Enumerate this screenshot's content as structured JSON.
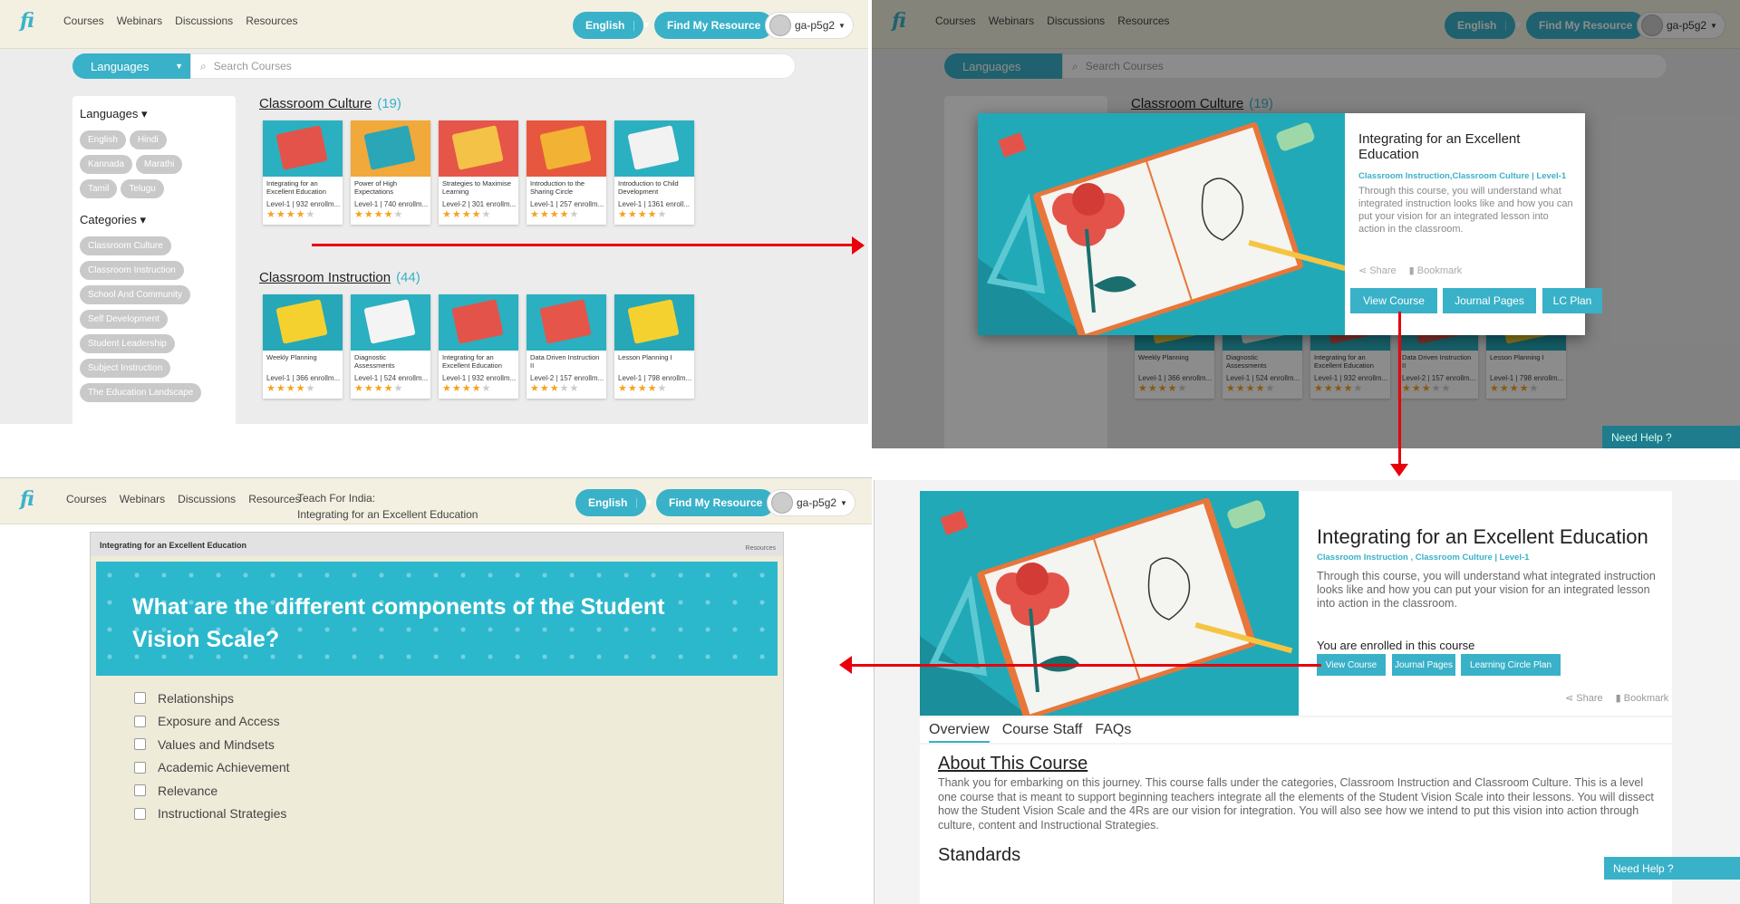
{
  "header": {
    "nav": [
      "Courses",
      "Webinars",
      "Discussions",
      "Resources"
    ],
    "language_label": "English",
    "find_resource_label": "Find My Resource",
    "user_name": "ga-p5g2",
    "breadcrumb_org": "Teach For India:",
    "breadcrumb_course": "Integrating for an Excellent Education"
  },
  "search": {
    "dropdown_label": "Languages",
    "placeholder": "Search Courses"
  },
  "sidebar": {
    "languages_title": "Languages",
    "languages": [
      "English",
      "Hindi",
      "Kannada",
      "Marathi",
      "Tamil",
      "Telugu"
    ],
    "categories_title": "Categories",
    "categories": [
      "Classroom Culture",
      "Classroom Instruction",
      "School And Community",
      "Self Development",
      "Student Leadership",
      "Subject Instruction",
      "The Education Landscape"
    ]
  },
  "sections": [
    {
      "title": "Classroom Culture",
      "count": "(19)",
      "courses": [
        {
          "title": "Integrating for an Excellent Education",
          "meta": "Level-1 | 932 enrollm...",
          "rating": 3.5
        },
        {
          "title": "Power of High Expectations",
          "meta": "Level-1 | 740 enrollm...",
          "rating": 4
        },
        {
          "title": "Strategies to Maximise Learning",
          "meta": "Level-2 | 301 enrollm...",
          "rating": 4
        },
        {
          "title": "Introduction to the Sharing Circle",
          "meta": "Level-1 | 257 enrollm...",
          "rating": 4
        },
        {
          "title": "Introduction to Child Development",
          "meta": "Level-1 | 1361 enroll...",
          "rating": 4
        }
      ]
    },
    {
      "title": "Classroom Instruction",
      "count": "(44)",
      "courses": [
        {
          "title": "Weekly Planning",
          "meta": "Level-1 | 366 enrollm...",
          "rating": 4
        },
        {
          "title": "Diagnostic Assessments",
          "meta": "Level-1 | 524 enrollm...",
          "rating": 4
        },
        {
          "title": "Integrating for an Excellent Education",
          "meta": "Level-1 | 932 enrollm...",
          "rating": 4
        },
        {
          "title": "Data Driven Instruction II",
          "meta": "Level-2 | 157 enrollm...",
          "rating": 3
        },
        {
          "title": "Lesson Planning I",
          "meta": "Level-1 | 798 enrollm...",
          "rating": 4
        }
      ]
    }
  ],
  "popup": {
    "title": "Integrating for an Excellent Education",
    "tags": "Classroom Instruction,Classroom Culture | Level-1",
    "description": "Through this course, you will understand what integrated instruction looks like and how you can put your vision for an integrated lesson into action in the classroom.",
    "share": "Share",
    "bookmark": "Bookmark",
    "view_course": "View Course",
    "journal_pages": "Journal Pages",
    "lc_plan": "LC Plan",
    "need_help": "Need Help ?"
  },
  "course_page": {
    "title": "Integrating for an Excellent Education",
    "tags": "Classroom Instruction , Classroom Culture | Level-1",
    "description": "Through this course, you will understand what integrated instruction looks like and how you can put your vision for an integrated lesson into action in the classroom.",
    "enrolled": "You are enrolled in this course",
    "view_course": "View Course",
    "journal_pages": "Journal Pages",
    "learning_circle_plan": "Learning Circle Plan",
    "share": "Share",
    "bookmark": "Bookmark",
    "tabs": [
      "Overview",
      "Course Staff",
      "FAQs"
    ],
    "about_title": "About This Course",
    "about_text": "Thank you for embarking on this journey. This course falls under the categories, Classroom Instruction and Classroom Culture. This is a level one course that is meant to support beginning teachers integrate all the elements of the Student Vision Scale into their lessons. You will dissect how the Student Vision Scale and the 4Rs are our vision for integration. You will also see how we intend to put this vision into action through culture, content and Instructional Strategies.",
    "standards_title": "Standards",
    "need_help": "Need Help ?"
  },
  "lesson": {
    "course_title": "Integrating for an Excellent Education",
    "resources": "Resources",
    "question": "What are the different components of the Student Vision Scale?",
    "options": [
      "Relationships",
      "Exposure and Access",
      "Values and Mindsets",
      "Academic Achievement",
      "Relevance",
      "Instructional Strategies"
    ]
  },
  "colors": {
    "accent": "#39b1c8",
    "header_bg": "#f3f0e1",
    "arrow": "#e8000b",
    "star": "#f6a21e"
  }
}
